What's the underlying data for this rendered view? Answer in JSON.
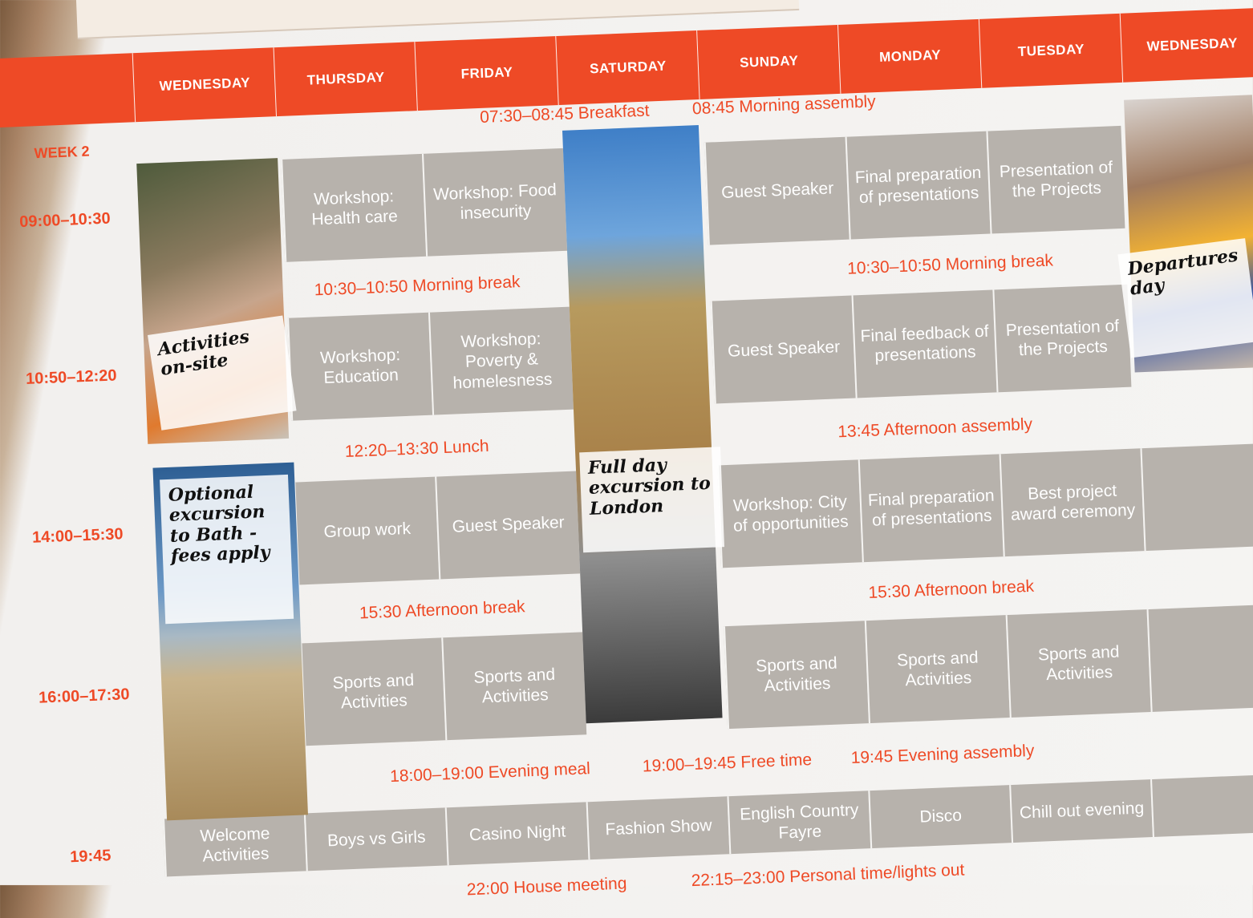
{
  "week_label": "WEEK 2",
  "days": [
    "WEDNESDAY",
    "THURSDAY",
    "FRIDAY",
    "SATURDAY",
    "SUNDAY",
    "MONDAY",
    "TUESDAY",
    "WEDNESDAY"
  ],
  "times": [
    "09:00–10:30",
    "10:50–12:20",
    "14:00–15:30",
    "16:00–17:30",
    "19:45"
  ],
  "notes": {
    "breakfast": "07:30–08:45 Breakfast",
    "assembly": "08:45 Morning assembly",
    "morning_break": "10:30–10:50 Morning break",
    "lunch": "12:20–13:30 Lunch",
    "afternoon_assembly": "13:45 Afternoon assembly",
    "afternoon_break": "15:30 Afternoon break",
    "evening_meal": "18:00–19:00  Evening meal",
    "free_time": "19:00–19:45 Free time",
    "evening_assembly": "19:45 Evening assembly",
    "house_meeting": "22:00 House meeting",
    "lights_out": "22:15–23:00 Personal time/lights out"
  },
  "slot1": {
    "thu": "Workshop: Health care",
    "fri": "Workshop: Food insecurity",
    "sun": "Guest Speaker",
    "mon": "Final preparation of presentations",
    "tue": "Presentation of the Projects"
  },
  "slot2": {
    "thu": "Workshop: Education",
    "fri": "Workshop: Poverty & homelesness",
    "sun": "Guest Speaker",
    "mon": "Final feedback of presentations",
    "tue": "Presentation of the Projects"
  },
  "slot3": {
    "thu": "Group work",
    "fri": "Guest Speaker",
    "sun": "Workshop: City of opportunities",
    "mon": "Final preparation of presentations",
    "tue": "Best project award ceremony"
  },
  "slot4": {
    "thu": "Sports and Activities",
    "fri": "Sports and Activities",
    "sun": "Sports and Activities",
    "mon": "Sports and Activities",
    "tue": "Sports and Activities"
  },
  "evening": {
    "wed": "Welcome Activities",
    "thu": "Boys vs Girls",
    "fri": "Casino Night",
    "sat": "Fashion Show",
    "sun": "English Country Fayre",
    "mon": "Disco",
    "tue": "Chill out evening"
  },
  "overlays": {
    "activities": "Activities on-site",
    "bath": "Optional excursion to Bath - fees apply",
    "london": "Full day excursion to London",
    "departures": "Departures day"
  }
}
